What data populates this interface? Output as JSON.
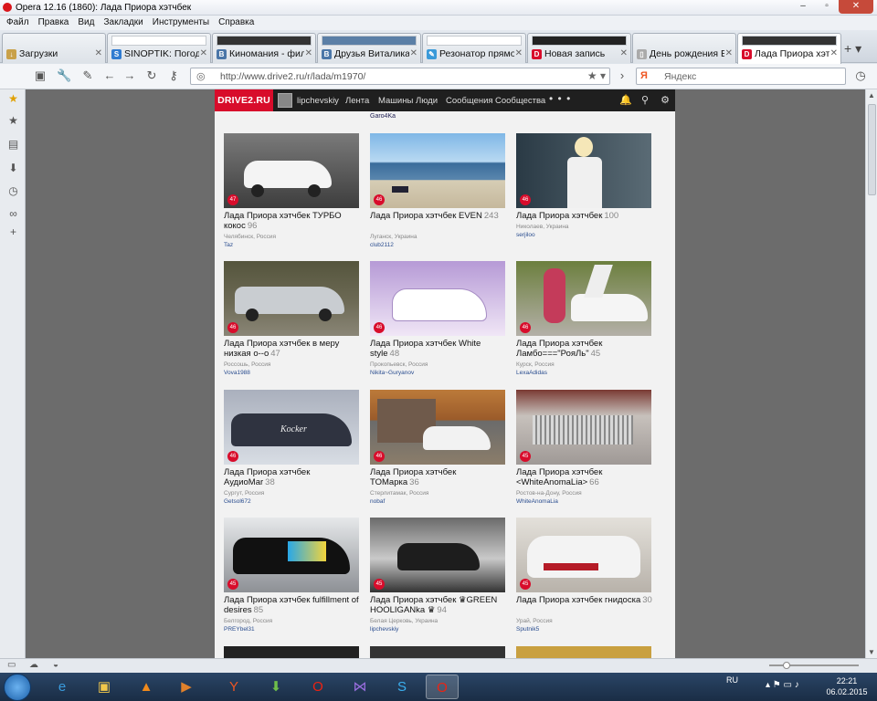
{
  "window": {
    "title": "Opera 12.16 (1860): Лада Приора хэтчбек"
  },
  "menu": [
    "Файл",
    "Правка",
    "Вид",
    "Закладки",
    "Инструменты",
    "Справка"
  ],
  "tabs": [
    {
      "label": "Загрузки",
      "icon": "downloads-icon"
    },
    {
      "label": "SINOPTIK: Погода...",
      "icon": "sinoptik-icon",
      "thumb": "sinoptik"
    },
    {
      "label": "Киномания - фил...",
      "icon": "vk-icon"
    },
    {
      "label": "Друзья Виталика ...",
      "icon": "vk-icon"
    },
    {
      "label": "Резонатор прямо...",
      "icon": "pen-icon"
    },
    {
      "label": "Новая запись",
      "icon": "drive2-icon"
    },
    {
      "label": "День рождения Б...",
      "icon": "page-icon"
    },
    {
      "label": "Лада Приора хэтч...",
      "icon": "drive2-icon",
      "active": true
    }
  ],
  "address": {
    "url": "http://www.drive2.ru/r/lada/m1970/"
  },
  "search": {
    "engine": "Я",
    "placeholder": "Яндекс"
  },
  "site": {
    "logo": "DRIVE2.RU",
    "username": "lipchevskiy",
    "nav": [
      "Лента",
      "Машины",
      "Люди",
      "Сообщения",
      "Сообщества"
    ],
    "more": "• • •",
    "top_user": "Garo4Ka"
  },
  "cards": [
    {
      "title": "Лада Приора хэтчбек ТУРБО кокос",
      "count": "96",
      "location": "Челябинск, Россия",
      "user": "Taz",
      "badge": "47",
      "scene": "white-car-parking"
    },
    {
      "title": "Лада Приора хэтчбек EVEN",
      "count": "243",
      "location": "Луганск, Украина",
      "user": "club2112",
      "badge": "46",
      "scene": "seaside"
    },
    {
      "title": "Лада Приора хэтчбек",
      "count": "100",
      "location": "Николаев, Украина",
      "user": "serjiloo",
      "badge": "46",
      "scene": "girl-with-car"
    },
    {
      "title": "Лада Приора хэтчбек в меру низкая о--о",
      "count": "47",
      "location": "Россошь, Россия",
      "user": "Vova1988",
      "badge": "46",
      "scene": "silver-car"
    },
    {
      "title": "Лада Приора хэтчбек White style",
      "count": "48",
      "location": "Прокопьевск, Россия",
      "user": "Nikita~Guryanov",
      "badge": "46",
      "scene": "purple-car"
    },
    {
      "title": "Лада Приора хэтчбек Ламбо===\"РояЛь\"",
      "count": "45",
      "location": "Курск, Россия",
      "user": "LexaAdidas",
      "badge": "46",
      "scene": "lambo-doors"
    },
    {
      "title": "Лада Приора хэтчбек АудиоMar",
      "count": "38",
      "location": "Сургут, Россия",
      "user": "Getsol672",
      "badge": "46",
      "scene": "dark-car-snow"
    },
    {
      "title": "Лада Приора хэтчбек TOMарка",
      "count": "36",
      "location": "Стерлитамак, Россия",
      "user": "nobaf",
      "badge": "46",
      "scene": "garage-autumn"
    },
    {
      "title": "Лада Приора хэтчбек <WhiteAnomaLia>",
      "count": "66",
      "location": "Ростов-на-Дону, Россия",
      "user": "WhiteAnomaLia",
      "badge": "45",
      "scene": "engine-bay"
    },
    {
      "title": "Лада Приора хэтчбек fulfillment of desires",
      "count": "85",
      "location": "Белгород, Россия",
      "user": "PREYbel31",
      "badge": "45",
      "scene": "black-car-wrap"
    },
    {
      "title": "Лада Приора хэтчбек ♛GREEN HOOLIGANka ♛",
      "count": "94",
      "location": "Белая Церковь, Украина",
      "user": "lipchevskiy",
      "badge": "45",
      "scene": "bw-car"
    },
    {
      "title": "Лада Приора хэтчбек гнидоска",
      "count": "30",
      "location": "Урай, Россия",
      "user": "Sputnik5",
      "badge": "45",
      "scene": "white-car-red"
    }
  ],
  "statusbar": {
    "zoom_level": 0.15
  },
  "taskbar": {
    "apps": [
      "windows-start",
      "ie-icon",
      "explorer-icon",
      "avast-icon",
      "media-icon",
      "yandex-icon",
      "green-icon",
      "opera-icon",
      "vs-icon",
      "skype-icon",
      "opera-active-icon"
    ],
    "lang": "RU",
    "time": "22:21",
    "date": "06.02.2015"
  },
  "colors": {
    "drive2_red": "#d80c2b",
    "header_dark": "#1f1f1f",
    "link_blue": "#2a4d8f"
  }
}
